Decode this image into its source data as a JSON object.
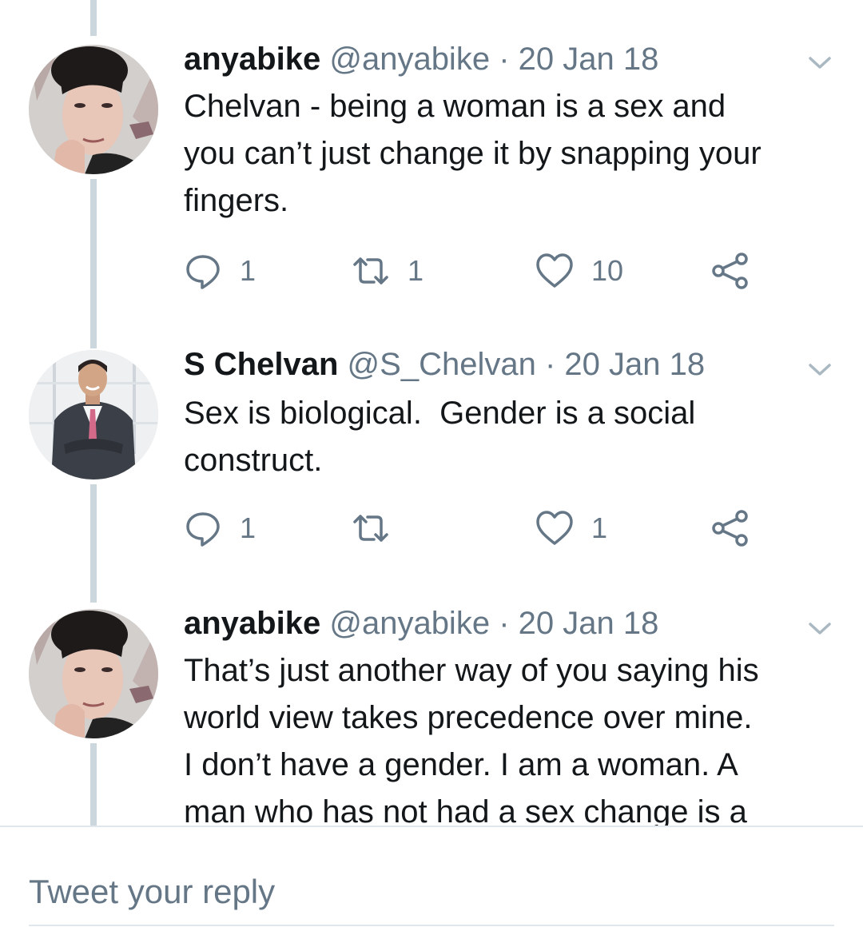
{
  "tweets": [
    {
      "name": "anyabike",
      "handle": "@anyabike",
      "separator": "·",
      "date": "20 Jan 18",
      "avatar": "woman-portrait-avatar",
      "lines": [
        "Chelvan - being a woman is a sex and",
        "you can’t just change it by snapping your",
        "fingers."
      ],
      "replies": "1",
      "retweets": "1",
      "likes": "10"
    },
    {
      "name": "S Chelvan",
      "handle": "@S_Chelvan",
      "separator": "·",
      "date": "20 Jan 18",
      "avatar": "man-in-suit-avatar",
      "lines": [
        "Sex is biological.  Gender is a social",
        "construct."
      ],
      "replies": "1",
      "retweets": "",
      "likes": "1"
    },
    {
      "name": "anyabike",
      "handle": "@anyabike",
      "separator": "·",
      "date": "20 Jan 18",
      "avatar": "woman-portrait-avatar",
      "lines": [
        "That’s just another way of you saying his",
        "world view takes precedence over mine.",
        "I don’t have a gender. I am a woman. A",
        "man who has not had a sex change is a"
      ]
    }
  ],
  "icons": {
    "reply": "speech-bubble-icon",
    "retweet": "retweet-arrows-icon",
    "like": "heart-icon",
    "share": "share-nodes-icon",
    "menu": "chevron-down-icon"
  },
  "reply_box": {
    "placeholder": "Tweet your reply"
  },
  "colors": {
    "text": "#14171a",
    "secondary": "#657786",
    "thread_line": "#ccd6dd",
    "divider": "#e1e8ed"
  }
}
